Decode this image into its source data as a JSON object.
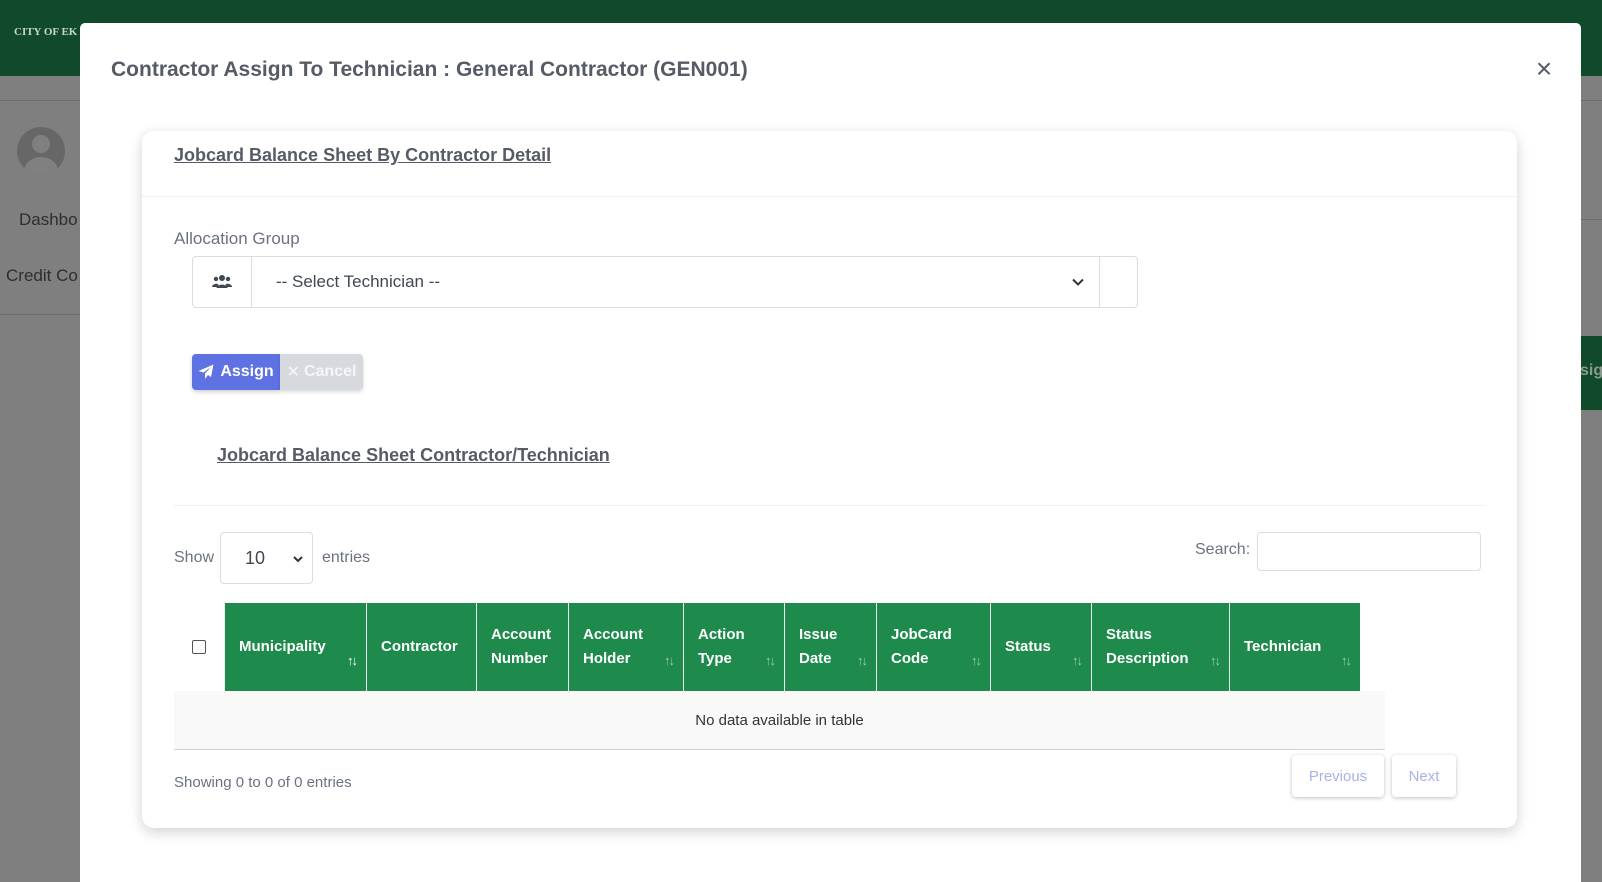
{
  "background": {
    "brand": "CITY OF EK",
    "nav": [
      "Dashbo",
      "Credit Co"
    ],
    "right_button": "sign"
  },
  "modal": {
    "title": "Contractor Assign To Technician : General Contractor (GEN001)",
    "close": "×"
  },
  "card": {
    "title": "Jobcard Balance Sheet By Contractor Detail",
    "allocation_label": "Allocation Group",
    "technician_select": "-- Select Technician --",
    "assign_button": "Assign",
    "cancel_button": "Cancel",
    "subtitle": "Jobcard Balance Sheet Contractor/Technician"
  },
  "table": {
    "show_label": "Show",
    "page_length": "10",
    "entries_label": "entries",
    "search_label": "Search:",
    "columns": [
      {
        "label": "Municipality"
      },
      {
        "label": "Contractor"
      },
      {
        "label": "Account Number"
      },
      {
        "label": "Account Holder"
      },
      {
        "label": "Action Type"
      },
      {
        "label": "Issue Date"
      },
      {
        "label": "JobCard Code"
      },
      {
        "label": "Status"
      },
      {
        "label": "Status Description"
      },
      {
        "label": "Technician"
      }
    ],
    "sort_icon": "↑↓",
    "empty_message": "No data available in table",
    "info": "Showing 0 to 0 of 0 entries",
    "previous": "Previous",
    "next": "Next"
  },
  "colors": {
    "header_green": "#1e8a4c",
    "topbar": "#104a2a",
    "assign": "#5e72e4",
    "cancel": "#d6d9dd"
  }
}
